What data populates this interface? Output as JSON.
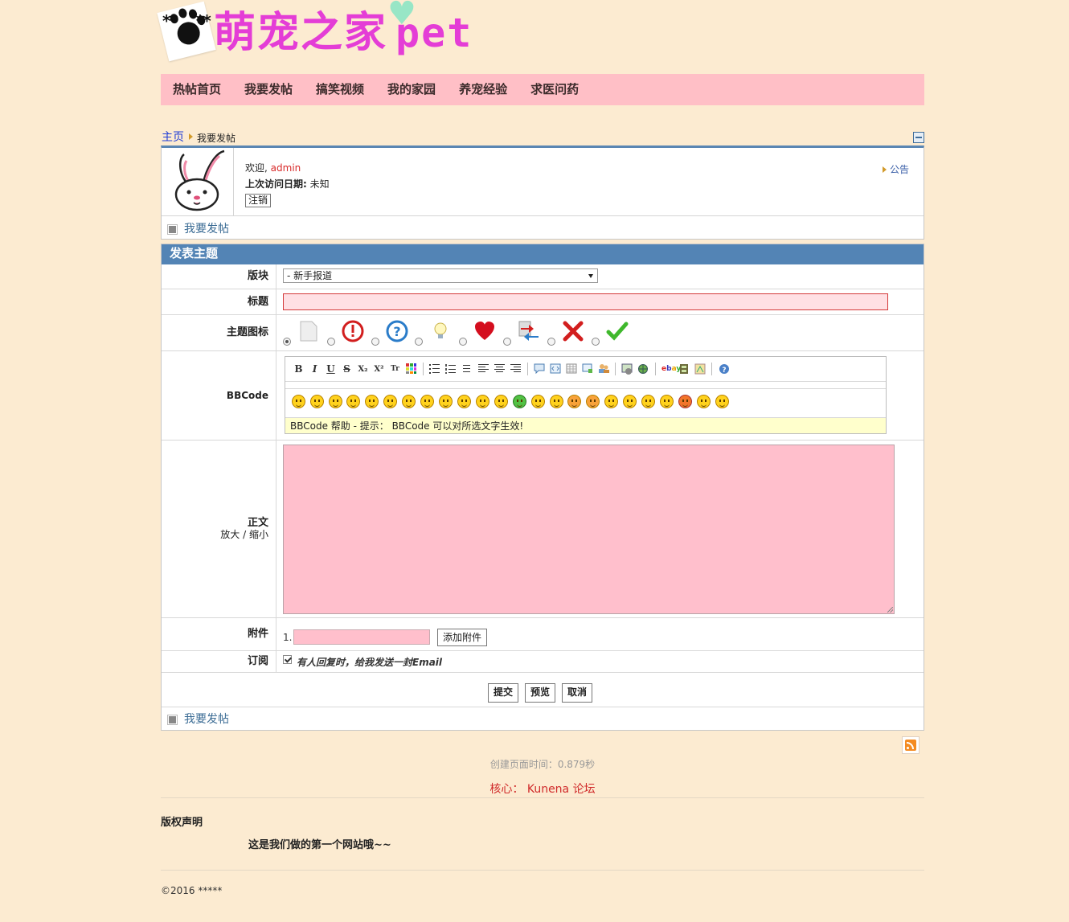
{
  "site": {
    "logo_text": "萌宠之家",
    "logo_suffix": "pet",
    "logo_stars": "*",
    "logo_heart": "♥"
  },
  "nav": [
    "热帖首页",
    "我要发帖",
    "搞笑视频",
    "我的家园",
    "养宠经验",
    "求医问药"
  ],
  "breadcrumb": {
    "home": "主页",
    "current": "我要发帖"
  },
  "user": {
    "welcome_prefix": "欢迎,",
    "name": "admin",
    "last_visit_label": "上次访问日期:",
    "last_visit_value": "未知",
    "logout": "注销",
    "notice": "公告"
  },
  "post_link": "我要发帖",
  "form": {
    "heading": "发表主题",
    "category_label": "版块",
    "category_value": "- 新手报道",
    "title_label": "标题",
    "topic_icon_label": "主题图标",
    "bbcode_label": "BBCode",
    "bbcode_help": "BBCode 帮助 - 提示： BBCode 可以对所选文字生效!",
    "body_label": "正文",
    "body_zoom_in": "放大",
    "body_zoom_sep": "/",
    "body_zoom_out": "缩小",
    "attachment_label": "附件",
    "attachment_index": "1.",
    "attachment_button": "添加附件",
    "subscribe_label": "订阅",
    "subscribe_text": "有人回复时，给我发送一封Email",
    "submit": "提交",
    "preview": "预览",
    "cancel": "取消"
  },
  "bbcode_tools": [
    "B",
    "I",
    "U",
    "S",
    "X₂",
    "X²",
    "Tr"
  ],
  "topic_icons": [
    "default-icon",
    "exclamation-icon",
    "question-icon",
    "lightbulb-icon",
    "heart-icon",
    "arrows-icon",
    "cross-icon",
    "check-icon"
  ],
  "footer": {
    "page_time": "创建页面时间：0.879秒",
    "powered": "核心： Kunena 论坛",
    "copyright_title": "版权声明",
    "copyright_text": "这是我们做的第一个网站哦~~",
    "copyright": "©2016 *****"
  },
  "colors": {
    "page_bg": "#fcebd1",
    "nav_bg": "#ffbfc6",
    "panel_head": "#5384b5",
    "logo": "#e43dd6",
    "link": "#3a6b94",
    "accent_red": "#d02a2a"
  }
}
